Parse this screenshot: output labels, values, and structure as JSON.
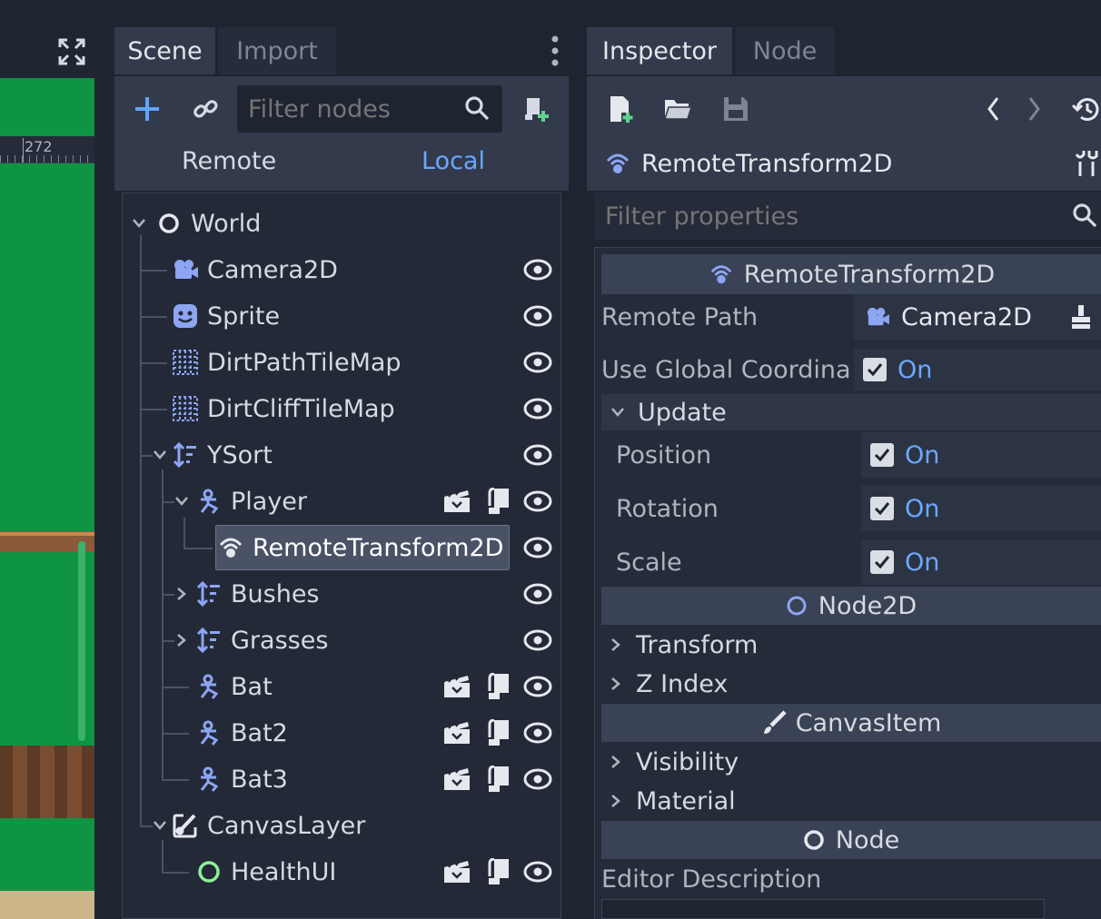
{
  "viewport": {
    "ruler_tick": "272"
  },
  "scene_dock": {
    "tabs": [
      "Scene",
      "Import"
    ],
    "filter_placeholder": "Filter nodes",
    "remote_label": "Remote",
    "local_label": "Local",
    "tree": [
      {
        "label": "World",
        "icon": "node-circle-icon"
      },
      {
        "label": "Camera2D",
        "icon": "camera-icon"
      },
      {
        "label": "Sprite",
        "icon": "sprite-icon"
      },
      {
        "label": "DirtPathTileMap",
        "icon": "tilemap-icon"
      },
      {
        "label": "DirtCliffTileMap",
        "icon": "tilemap-icon"
      },
      {
        "label": "YSort",
        "icon": "ysort-icon"
      },
      {
        "label": "Player",
        "icon": "kinematic-body-icon"
      },
      {
        "label": "RemoteTransform2D",
        "icon": "remote-transform-icon"
      },
      {
        "label": "Bushes",
        "icon": "ysort-icon"
      },
      {
        "label": "Grasses",
        "icon": "ysort-icon"
      },
      {
        "label": "Bat",
        "icon": "kinematic-body-icon"
      },
      {
        "label": "Bat2",
        "icon": "kinematic-body-icon"
      },
      {
        "label": "Bat3",
        "icon": "kinematic-body-icon"
      },
      {
        "label": "CanvasLayer",
        "icon": "canvas-layer-icon"
      },
      {
        "label": "HealthUI",
        "icon": "control-circle-icon"
      }
    ]
  },
  "inspector": {
    "tabs": [
      "Inspector",
      "Node"
    ],
    "object_name": "RemoteTransform2D",
    "filter_placeholder": "Filter properties",
    "section_remote": "RemoteTransform2D",
    "remote_path_label": "Remote Path",
    "remote_path_value": "Camera2D",
    "use_global_label": "Use Global Coordina",
    "on_text": "On",
    "update_label": "Update",
    "position_label": "Position",
    "rotation_label": "Rotation",
    "scale_label": "Scale",
    "section_node2d": "Node2D",
    "transform_label": "Transform",
    "zindex_label": "Z Index",
    "section_canvasitem": "CanvasItem",
    "visibility_label": "Visibility",
    "material_label": "Material",
    "section_node": "Node",
    "editor_description_label": "Editor Description"
  },
  "colors": {
    "accent": "#6aa8ff",
    "icon_blue": "#8da5f3",
    "healthui_green": "#8eef97"
  }
}
